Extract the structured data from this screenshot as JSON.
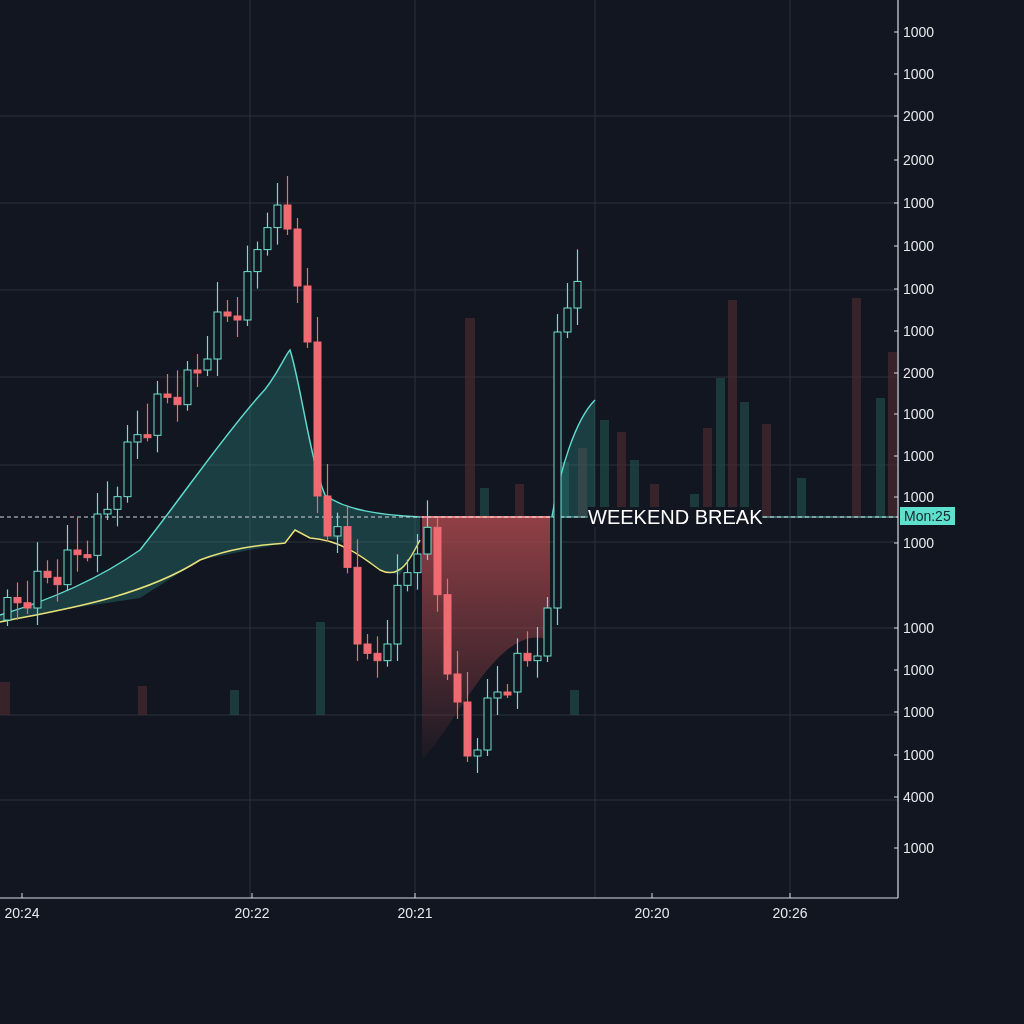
{
  "price_axis": {
    "labels": [
      "1000",
      "1000",
      "2000",
      "2000",
      "1000",
      "1000",
      "1000",
      "1000",
      "2000",
      "1000",
      "1000",
      "1000",
      "1000",
      "1000",
      "1000",
      "1000",
      "1000",
      "4000",
      "1000"
    ]
  },
  "time_axis": {
    "labels": [
      "20:24",
      "20:22",
      "20:21",
      "20:20",
      "20:26"
    ]
  },
  "session_marker": {
    "label": "WEEKEND BREAK"
  },
  "price_tag": {
    "label": "Mon:25"
  }
}
